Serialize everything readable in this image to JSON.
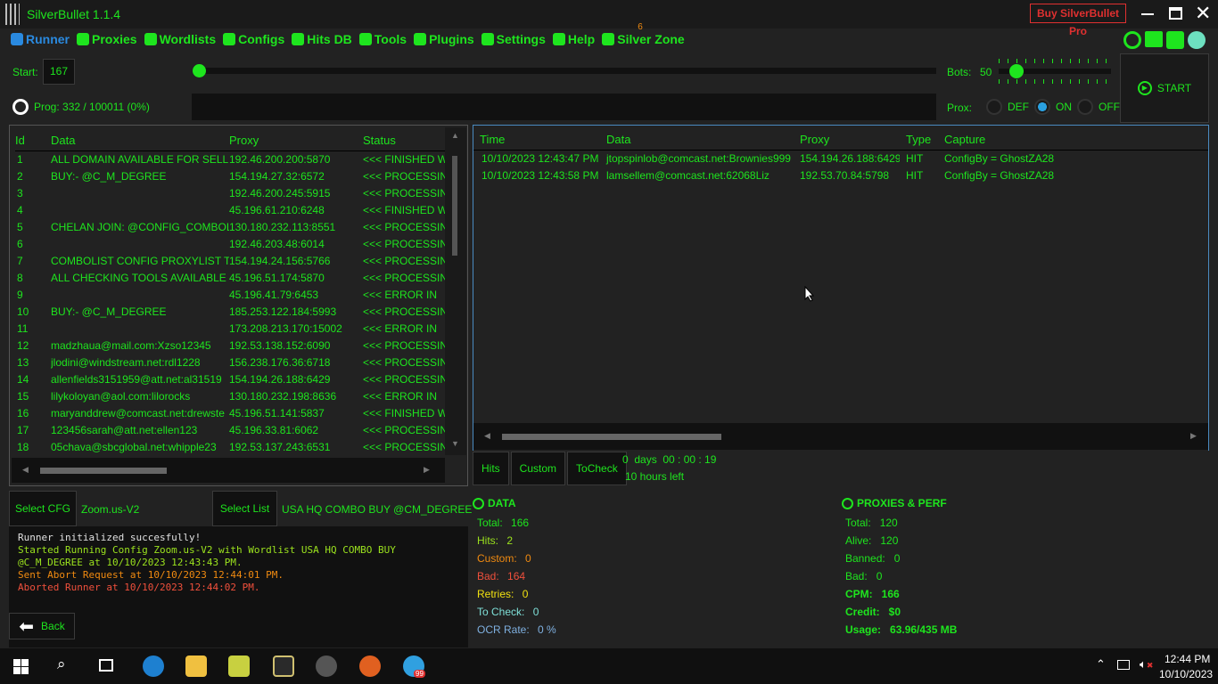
{
  "window": {
    "title": "SilverBullet 1.1.4",
    "buy_pro": "Buy SilverBullet Pro"
  },
  "nav": [
    {
      "label": "Runner",
      "icon": "runner-icon"
    },
    {
      "label": "Proxies",
      "icon": "server-icon"
    },
    {
      "label": "Wordlists",
      "icon": "files-icon"
    },
    {
      "label": "Configs",
      "icon": "gear-wheel-icon"
    },
    {
      "label": "Hits DB",
      "icon": "database-icon"
    },
    {
      "label": "Tools",
      "icon": "tools-icon"
    },
    {
      "label": "Plugins",
      "icon": "plug-icon"
    },
    {
      "label": "Settings",
      "icon": "gear-icon"
    },
    {
      "label": "Help",
      "icon": "help-icon"
    },
    {
      "label": "Silver Zone",
      "icon": "location-icon",
      "badge": "6"
    }
  ],
  "controls": {
    "start_label": "Start:",
    "start_value": "167",
    "progress_label": "Prog: 332 / 100011 (0%)",
    "progress_percent": 0,
    "bots_label": "Bots:",
    "bots_value": "50",
    "prox_label": "Prox:",
    "prox_options": [
      "DEF",
      "ON",
      "OFF"
    ],
    "prox_selected": "ON",
    "start_button": "START"
  },
  "data_table": {
    "headers": [
      "Id",
      "Data",
      "Proxy",
      "Status"
    ],
    "rows": [
      [
        "1",
        "ALL DOMAIN AVAILABLE FOR SELL",
        "192.46.200.200:5870",
        "<<< FINISHED W"
      ],
      [
        "2",
        "BUY:- @C_M_DEGREE",
        "154.194.27.32:6572",
        "<<< PROCESSIN"
      ],
      [
        "3",
        "",
        "192.46.200.245:5915",
        "<<< PROCESSIN"
      ],
      [
        "4",
        "",
        "45.196.61.210:6248",
        "<<< FINISHED W"
      ],
      [
        "5",
        "CHELAN JOIN: @CONFIG_COMBOL",
        "130.180.232.113:8551",
        "<<< PROCESSIN"
      ],
      [
        "6",
        "",
        "192.46.203.48:6014",
        "<<< PROCESSIN"
      ],
      [
        "7",
        "COMBOLIST CONFIG PROXYLIST TO",
        "154.194.24.156:5766",
        "<<< PROCESSIN"
      ],
      [
        "8",
        "ALL CHECKING TOOLS AVAILABLE F",
        "45.196.51.174:5870",
        "<<< PROCESSIN"
      ],
      [
        "9",
        "",
        "45.196.41.79:6453",
        "<<< ERROR IN"
      ],
      [
        "10",
        "BUY:- @C_M_DEGREE",
        "185.253.122.184:5993",
        "<<< PROCESSIN"
      ],
      [
        "11",
        "",
        "173.208.213.170:15002",
        "<<< ERROR IN"
      ],
      [
        "12",
        "madzhaua@mail.com:Xzso12345",
        "192.53.138.152:6090",
        "<<< PROCESSIN"
      ],
      [
        "13",
        "jlodini@windstream.net:rdl1228",
        "156.238.176.36:6718",
        "<<< PROCESSIN"
      ],
      [
        "14",
        "allenfields3151959@att.net:al31519",
        "154.194.26.188:6429",
        "<<< PROCESSIN"
      ],
      [
        "15",
        "lilykoloyan@aol.com:lilorocks",
        "130.180.232.198:8636",
        "<<< ERROR IN"
      ],
      [
        "16",
        "maryanddrew@comcast.net:drewste",
        "45.196.51.141:5837",
        "<<< FINISHED W"
      ],
      [
        "17",
        "123456sarah@att.net:ellen123",
        "45.196.33.81:6062",
        "<<< PROCESSIN"
      ],
      [
        "18",
        "05chava@sbcglobal.net:whipple23",
        "192.53.137.243:6531",
        "<<< PROCESSIN"
      ]
    ]
  },
  "hits_table": {
    "headers": [
      "Time",
      "Data",
      "Proxy",
      "Type",
      "Capture"
    ],
    "rows": [
      [
        "10/10/2023 12:43:47 PM",
        "jtopspinlob@comcast.net:Brownies999",
        "154.194.26.188:6429",
        "HIT",
        "ConfigBy = GhostZA28"
      ],
      [
        "10/10/2023 12:43:58 PM",
        "lamsellem@comcast.net:62068Liz",
        "192.53.70.84:5798",
        "HIT",
        "ConfigBy = GhostZA28"
      ]
    ]
  },
  "tabs": [
    "Hits",
    "Custom",
    "ToCheck"
  ],
  "timer": {
    "elapsed": "0  days  00 : 00 : 19",
    "left": "10 hours left"
  },
  "config": {
    "select_cfg": "Select CFG",
    "cfg_name": "Zoom.us-V2",
    "select_list": "Select List",
    "list_name": "USA HQ COMBO BUY @CM_DEGREE"
  },
  "log": [
    {
      "text": "Runner initialized succesfully!",
      "color": "#e0e0e0"
    },
    {
      "text": "Started Running Config Zoom.us-V2 with Wordlist USA HQ COMBO BUY @C_M_DEGREE at 10/10/2023 12:43:43 PM.",
      "color": "#9be21e"
    },
    {
      "text": "Sent Abort Request at 10/10/2023 12:44:01 PM.",
      "color": "#f08a10"
    },
    {
      "text": "Aborted Runner at 10/10/2023 12:44:02 PM.",
      "color": "#f0503c"
    }
  ],
  "back": "Back",
  "data_stats": {
    "title": "DATA",
    "items": [
      {
        "label": "Total:",
        "value": "166",
        "color": "#1ee51e"
      },
      {
        "label": "Hits:",
        "value": "2",
        "color": "#9be21e"
      },
      {
        "label": "Custom:",
        "value": "0",
        "color": "#f08a10"
      },
      {
        "label": "Bad:",
        "value": "164",
        "color": "#f0503c"
      },
      {
        "label": "Retries:",
        "value": "0",
        "color": "#f0e010"
      },
      {
        "label": "To Check:",
        "value": "0",
        "color": "#7fe0d8"
      },
      {
        "label": "OCR Rate:",
        "value": "0 %",
        "color": "#7fb0e0"
      }
    ]
  },
  "proxy_stats": {
    "title": "PROXIES & PERF",
    "items": [
      {
        "label": "Total:",
        "value": "120",
        "bold": false
      },
      {
        "label": "Alive:",
        "value": "120",
        "bold": false
      },
      {
        "label": "Banned:",
        "value": "0",
        "bold": false
      },
      {
        "label": "Bad:",
        "value": "0",
        "bold": false
      },
      {
        "label": "CPM:",
        "value": "166",
        "bold": true
      },
      {
        "label": "Credit:",
        "value": "$0",
        "bold": true
      },
      {
        "label": "Usage:",
        "value": "63.96/435 MB",
        "bold": true
      }
    ]
  },
  "taskbar": {
    "time": "12:44 PM",
    "date": "10/10/2023",
    "telegram_badge": "99"
  }
}
